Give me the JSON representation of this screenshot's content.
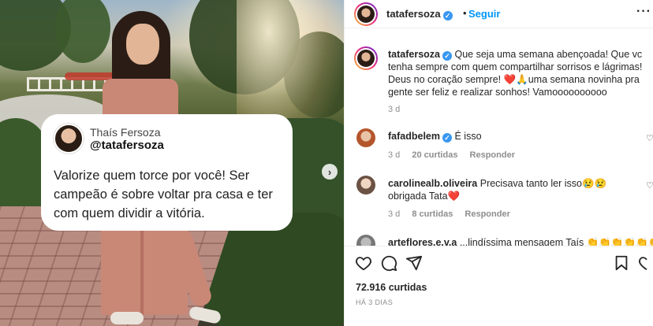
{
  "post": {
    "tweet": {
      "name": "Thaís Fersoza",
      "handle": "@tatafersoza",
      "text": "Valorize quem torce por você! Ser campeão é sobre voltar pra casa e ter com quem dividir a vitória."
    },
    "next_arrow": "›"
  },
  "header": {
    "username": "tatafersoza",
    "verified": "✓",
    "separator": "•",
    "follow_label": "Seguir",
    "more": "···"
  },
  "caption": {
    "username": "tatafersoza",
    "text": "Que seja uma semana abençoada! Que vc tenha sempre com quem compartilhar sorrisos e lágrimas! Deus no coração sempre! ❤️🙏uma semana novinha pra gente ser feliz e realizar sonhos! Vamoooooooooo",
    "age": "3 d"
  },
  "comments": [
    {
      "username": "fafadbelem",
      "verified": "✓",
      "text": "É isso",
      "age": "3 d",
      "likes": "20 curtidas",
      "reply": "Responder"
    },
    {
      "username": "carolinealb.oliveira",
      "text": "Precisava tanto ler isso😢😢obrigada Tata❤️",
      "age": "3 d",
      "likes": "8 curtidas",
      "reply": "Responder"
    },
    {
      "username": "arteflores.e.v.a",
      "text": "...lindíssima mensagem Taís 👏👏👏👏👏👏👏"
    }
  ],
  "footer": {
    "likes": "72.916 curtidas",
    "posted_ago": "HÁ 3 DIAS"
  },
  "colors": {
    "accent": "#0095f6",
    "verified": "#3897f0",
    "muted": "#8e8e8e",
    "text": "#262626"
  }
}
